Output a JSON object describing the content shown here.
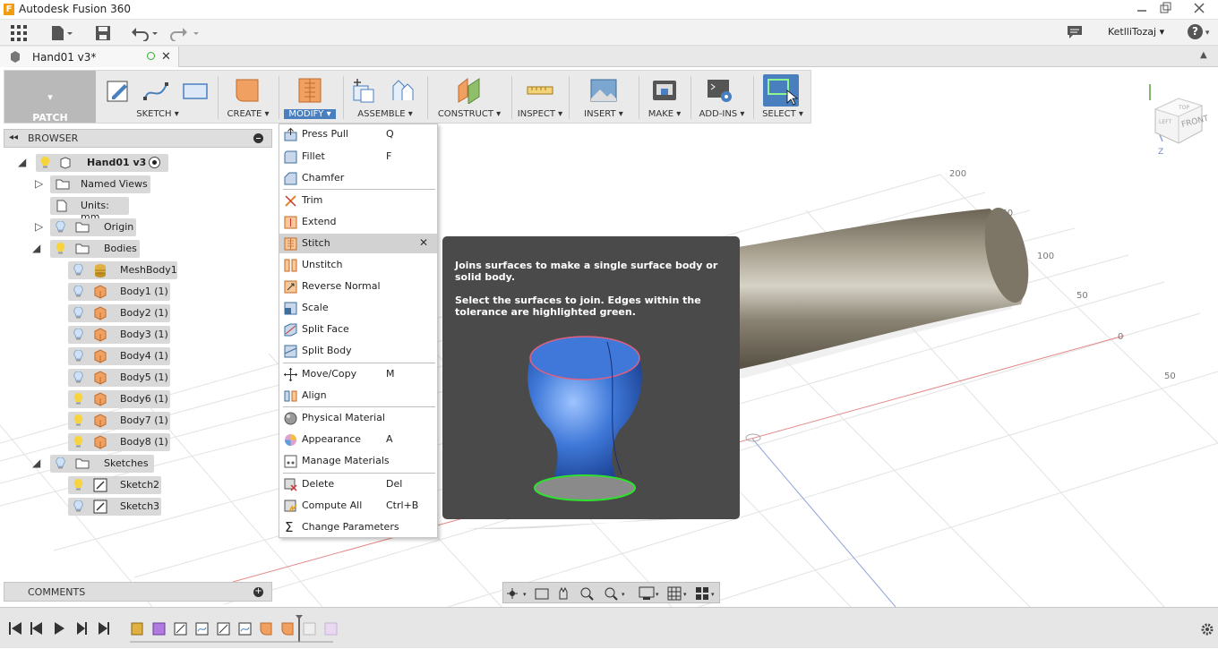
{
  "app": {
    "title": "Autodesk Fusion 360"
  },
  "quick_access": {
    "user": "KetlliTozaj",
    "help": "?"
  },
  "document_tab": {
    "title": "Hand01 v3*"
  },
  "toolbar": {
    "workspace": "PATCH",
    "groups": [
      {
        "label": "SKETCH"
      },
      {
        "label": "CREATE"
      },
      {
        "label": "MODIFY"
      },
      {
        "label": "ASSEMBLE"
      },
      {
        "label": "CONSTRUCT"
      },
      {
        "label": "INSPECT"
      },
      {
        "label": "INSERT"
      },
      {
        "label": "MAKE"
      },
      {
        "label": "ADD-INS"
      },
      {
        "label": "SELECT"
      }
    ]
  },
  "browser": {
    "title": "BROWSER",
    "items": [
      {
        "label": "Hand01 v3"
      },
      {
        "label": "Named Views"
      },
      {
        "label": "Units: mm"
      },
      {
        "label": "Origin"
      },
      {
        "label": "Bodies"
      },
      {
        "label": "MeshBody1"
      },
      {
        "label": "Body1 (1)"
      },
      {
        "label": "Body2 (1)"
      },
      {
        "label": "Body3 (1)"
      },
      {
        "label": "Body4 (1)"
      },
      {
        "label": "Body5 (1)"
      },
      {
        "label": "Body6 (1)"
      },
      {
        "label": "Body7 (1)"
      },
      {
        "label": "Body8 (1)"
      },
      {
        "label": "Sketches"
      },
      {
        "label": "Sketch2"
      },
      {
        "label": "Sketch3"
      }
    ]
  },
  "modify_menu": {
    "items": [
      {
        "label": "Press Pull",
        "shortcut": "Q"
      },
      {
        "label": "Fillet",
        "shortcut": "F"
      },
      {
        "label": "Chamfer",
        "shortcut": ""
      },
      {
        "label": "Trim",
        "shortcut": ""
      },
      {
        "label": "Extend",
        "shortcut": ""
      },
      {
        "label": "Stitch",
        "shortcut": ""
      },
      {
        "label": "Unstitch",
        "shortcut": ""
      },
      {
        "label": "Reverse Normal",
        "shortcut": ""
      },
      {
        "label": "Scale",
        "shortcut": ""
      },
      {
        "label": "Split Face",
        "shortcut": ""
      },
      {
        "label": "Split Body",
        "shortcut": ""
      },
      {
        "label": "Move/Copy",
        "shortcut": "M"
      },
      {
        "label": "Align",
        "shortcut": ""
      },
      {
        "label": "Physical Material",
        "shortcut": ""
      },
      {
        "label": "Appearance",
        "shortcut": "A"
      },
      {
        "label": "Manage Materials",
        "shortcut": ""
      },
      {
        "label": "Delete",
        "shortcut": "Del"
      },
      {
        "label": "Compute All",
        "shortcut": "Ctrl+B"
      },
      {
        "label": "Change Parameters",
        "shortcut": ""
      }
    ]
  },
  "tooltip": {
    "line1": "Joins surfaces to make a single surface body or solid body.",
    "line2": "Select the surfaces to join. Edges within the tolerance are highlighted green."
  },
  "comments": {
    "title": "COMMENTS"
  },
  "viewcube": {
    "top": "TOP",
    "front": "FRONT",
    "left": "LEFT",
    "z": "Z"
  },
  "grid_labels": [
    "200",
    "150",
    "100",
    "50",
    "0",
    "50"
  ],
  "colors": {
    "accent": "#4a7fbf",
    "tooltip_bg": "#4a4a4a",
    "highlight": "#d0d0d0"
  }
}
